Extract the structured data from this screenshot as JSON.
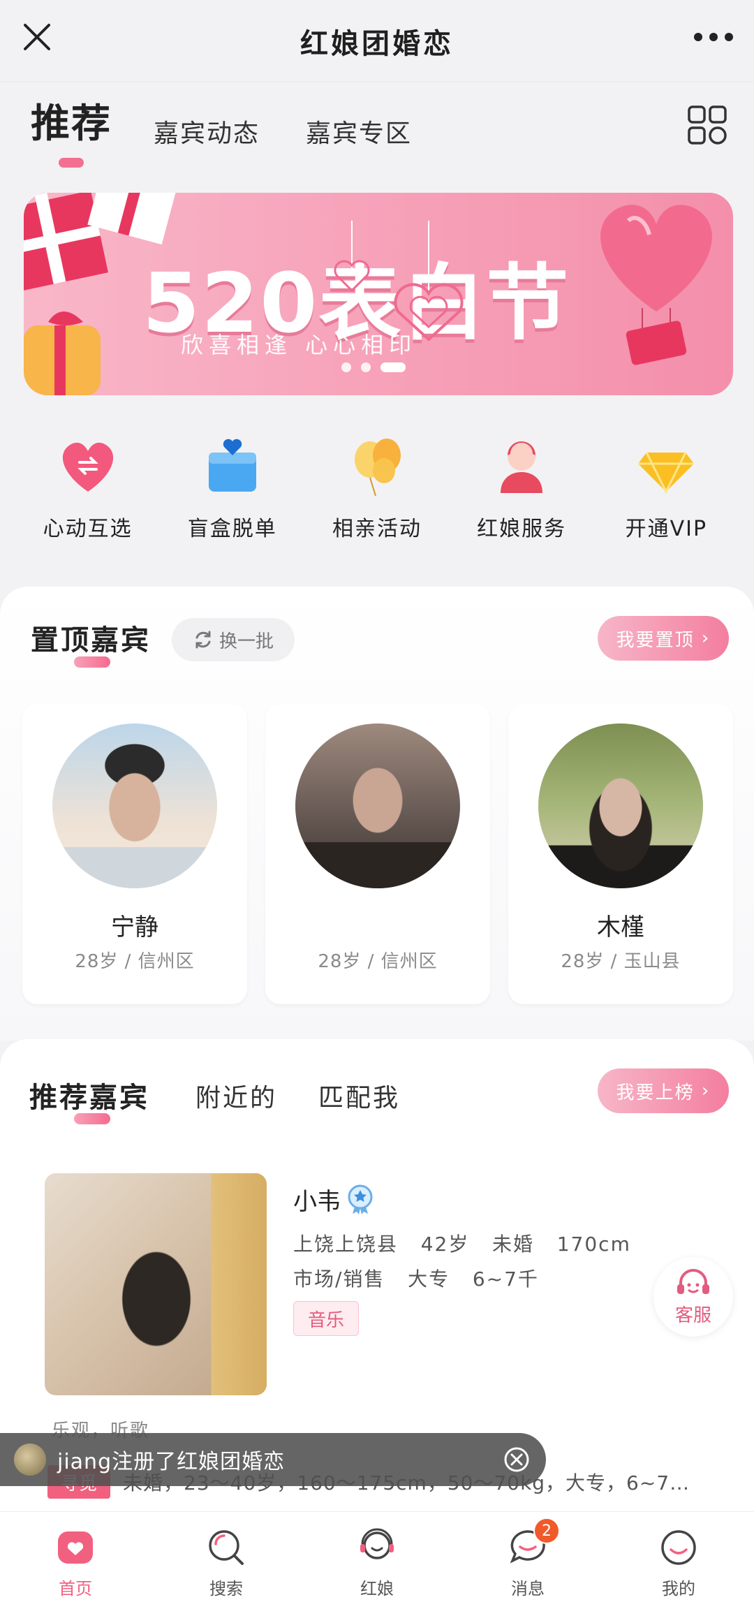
{
  "topbar": {
    "title": "红娘团婚恋"
  },
  "tabs": [
    {
      "label": "推荐"
    },
    {
      "label": "嘉宾动态"
    },
    {
      "label": "嘉宾专区"
    }
  ],
  "banner": {
    "headline": "520表白节",
    "subline": "欣喜相逢 心心相印"
  },
  "quick_entries": [
    {
      "label": "心动互选",
      "icon": "heart-swap-icon"
    },
    {
      "label": "盲盒脱单",
      "icon": "blind-box-icon"
    },
    {
      "label": "相亲活动",
      "icon": "balloons-icon"
    },
    {
      "label": "红娘服务",
      "icon": "matchmaker-icon"
    },
    {
      "label": "开通VIP",
      "icon": "diamond-icon"
    }
  ],
  "top_guests": {
    "title": "置顶嘉宾",
    "swap_label": "换一批",
    "action_label": "我要置顶",
    "cards": [
      {
        "name": "宁静",
        "meta": "28岁 / 信州区"
      },
      {
        "name": "",
        "meta": "28岁 / 信州区"
      },
      {
        "name": "木槿",
        "meta": "28岁 / 玉山县"
      }
    ]
  },
  "recommend": {
    "tabs": [
      {
        "label": "推荐嘉宾"
      },
      {
        "label": "附近的"
      },
      {
        "label": "匹配我"
      }
    ],
    "action_label": "我要上榜",
    "profile": {
      "name": "小韦",
      "line1": "上饶上饶县   42岁   未婚   170cm",
      "line2": "市场/销售   大专   6~7千",
      "tag": "音乐",
      "intro": "乐观，听歌",
      "seek_label": "寻觅",
      "seek_text": "未婚，23～40岁，160～175cm，50～70kg，大专，6~7…"
    }
  },
  "service": {
    "label": "客服"
  },
  "toast": {
    "text": "jiang注册了红娘团婚恋"
  },
  "tabbar": [
    {
      "label": "首页",
      "icon": "home-icon",
      "active": true
    },
    {
      "label": "搜索",
      "icon": "search-icon"
    },
    {
      "label": "红娘",
      "icon": "matchmaker-icon"
    },
    {
      "label": "消息",
      "icon": "message-icon",
      "badge": "2"
    },
    {
      "label": "我的",
      "icon": "profile-icon"
    }
  ],
  "colors": {
    "accent": "#f2607f",
    "pink_light": "#f7b6c8",
    "badge": "#f05a2a"
  }
}
